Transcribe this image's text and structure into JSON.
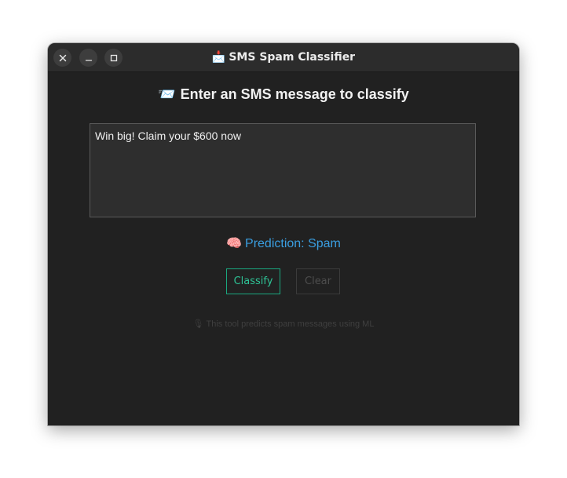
{
  "window": {
    "title_icon": "📩",
    "title": "SMS Spam Classifier",
    "controls": {
      "close_icon": "close-icon",
      "minimize_icon": "minimize-icon",
      "maximize_icon": "maximize-icon"
    }
  },
  "main": {
    "heading_icon": "📨",
    "heading": "Enter an SMS message to classify",
    "message_text": "Win big! Claim your $600 now",
    "prediction_icon": "🧠",
    "prediction": "Prediction: Spam",
    "classify_label": "Classify",
    "clear_label": "Clear",
    "footer_icon": "🎙",
    "footer": "This tool predicts spam messages using ML"
  },
  "colors": {
    "background": "#212121",
    "prediction": "#3a9ee0",
    "classify_accent": "#2ec396",
    "disabled": "#4d4d4d"
  }
}
